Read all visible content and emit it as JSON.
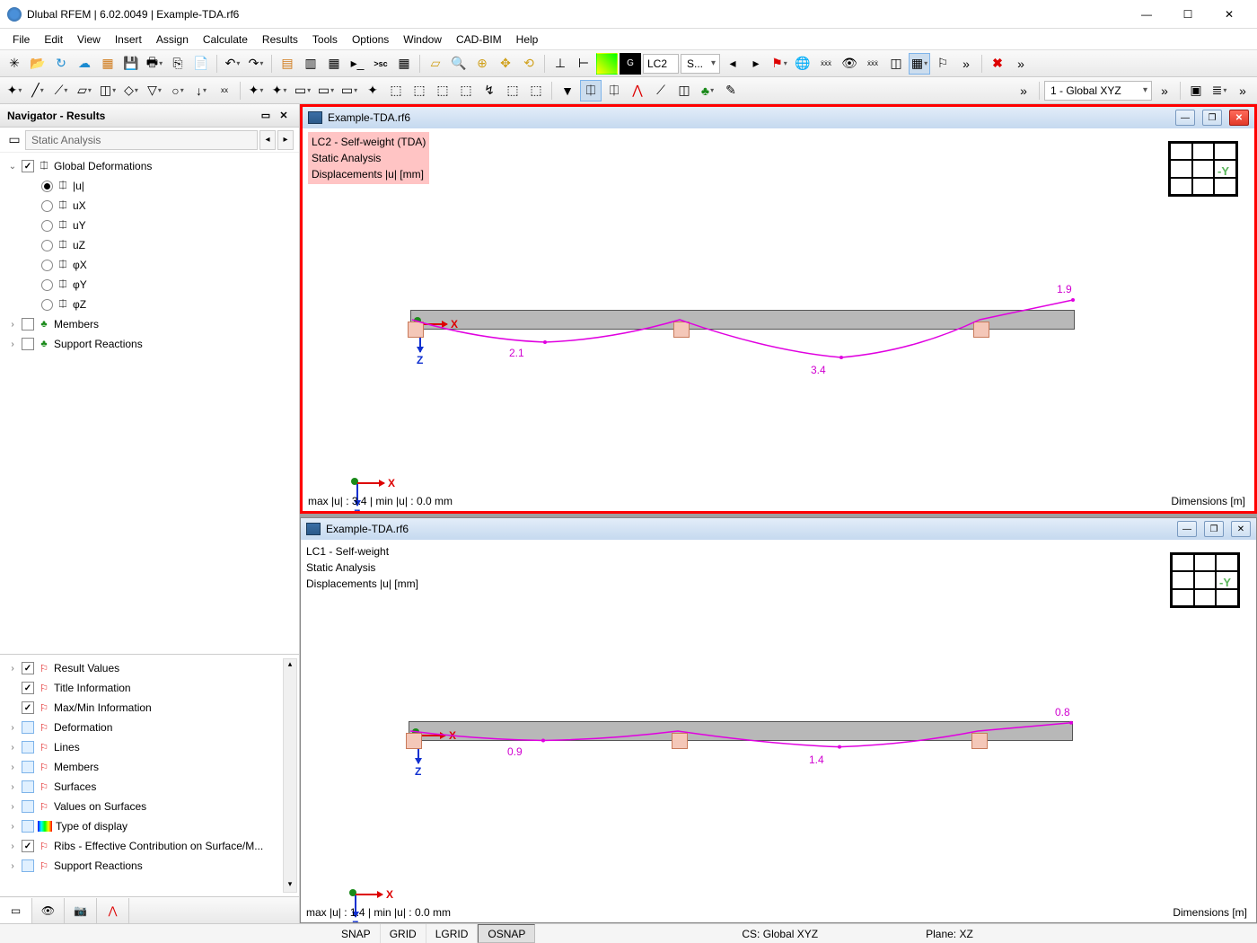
{
  "app": {
    "title": "Dlubal RFEM | 6.02.0049 | Example-TDA.rf6"
  },
  "menu": [
    "File",
    "Edit",
    "View",
    "Insert",
    "Assign",
    "Calculate",
    "Results",
    "Tools",
    "Options",
    "Window",
    "CAD-BIM",
    "Help"
  ],
  "toolbar1": {
    "lc_combo": "LC2",
    "s_combo": "S...",
    "cs_combo": "1 - Global XYZ"
  },
  "navigator": {
    "title": "Navigator - Results",
    "combo": "Static Analysis",
    "tree_top": {
      "root": {
        "label": "Global Deformations",
        "checked": true
      },
      "radios": [
        {
          "label": "|u|",
          "on": true
        },
        {
          "label": "uX",
          "on": false
        },
        {
          "label": "uY",
          "on": false
        },
        {
          "label": "uZ",
          "on": false
        },
        {
          "label": "φX",
          "on": false
        },
        {
          "label": "φY",
          "on": false
        },
        {
          "label": "φZ",
          "on": false
        }
      ],
      "others": [
        {
          "label": "Members",
          "checked": false
        },
        {
          "label": "Support Reactions",
          "checked": false
        }
      ]
    },
    "tree_bottom": [
      {
        "label": "Result Values",
        "checked": true,
        "expandable": true
      },
      {
        "label": "Title Information",
        "checked": true,
        "expandable": false
      },
      {
        "label": "Max/Min Information",
        "checked": true,
        "expandable": false
      },
      {
        "label": "Deformation",
        "checked": "box",
        "expandable": true
      },
      {
        "label": "Lines",
        "checked": "box",
        "expandable": true
      },
      {
        "label": "Members",
        "checked": "box",
        "expandable": true
      },
      {
        "label": "Surfaces",
        "checked": "box",
        "expandable": true
      },
      {
        "label": "Values on Surfaces",
        "checked": "box",
        "expandable": true
      },
      {
        "label": "Type of display",
        "checked": "box",
        "expandable": true,
        "rainbow": true
      },
      {
        "label": "Ribs - Effective Contribution on Surface/M...",
        "checked": true,
        "expandable": true
      },
      {
        "label": "Support Reactions",
        "checked": "box",
        "expandable": true
      }
    ]
  },
  "viewports": [
    {
      "title": "Example-TDA.rf6",
      "active": true,
      "info": [
        "LC2 - Self-weight (TDA)",
        "Static Analysis",
        "Displacements |u| [mm]"
      ],
      "highlight": true,
      "cube_label": "-Y",
      "footer_left": "max |u| : 3.4 | min |u| : 0.0 mm",
      "footer_right": "Dimensions [m]",
      "values": {
        "v1": "2.1",
        "v2": "3.4",
        "v3": "1.9"
      }
    },
    {
      "title": "Example-TDA.rf6",
      "active": false,
      "info": [
        "LC1 - Self-weight",
        "Static Analysis",
        "Displacements |u| [mm]"
      ],
      "highlight": false,
      "cube_label": "-Y",
      "footer_left": "max |u| : 1.4 | min |u| : 0.0 mm",
      "footer_right": "Dimensions [m]",
      "values": {
        "v1": "0.9",
        "v2": "1.4",
        "v3": "0.8"
      }
    }
  ],
  "statusbar": {
    "snap": "SNAP",
    "grid": "GRID",
    "lgrid": "LGRID",
    "osnap": "OSNAP",
    "cs": "CS: Global XYZ",
    "plane": "Plane: XZ"
  },
  "chart_data": [
    {
      "type": "line",
      "title": "Displacements |u| [mm] — LC2 Self-weight (TDA)",
      "xlabel": "X",
      "ylabel": "Z (down)",
      "spans": 3,
      "supports_x_fraction": [
        0.0,
        0.4,
        0.85
      ],
      "labeled_values": {
        "span1_peak": 2.1,
        "span2_peak": 3.4,
        "cantilever_tip": 1.9
      },
      "max": 3.4,
      "min": 0.0,
      "units": "mm"
    },
    {
      "type": "line",
      "title": "Displacements |u| [mm] — LC1 Self-weight",
      "xlabel": "X",
      "ylabel": "Z (down)",
      "spans": 3,
      "supports_x_fraction": [
        0.0,
        0.4,
        0.85
      ],
      "labeled_values": {
        "span1_peak": 0.9,
        "span2_peak": 1.4,
        "cantilever_tip": 0.8
      },
      "max": 1.4,
      "min": 0.0,
      "units": "mm"
    }
  ]
}
